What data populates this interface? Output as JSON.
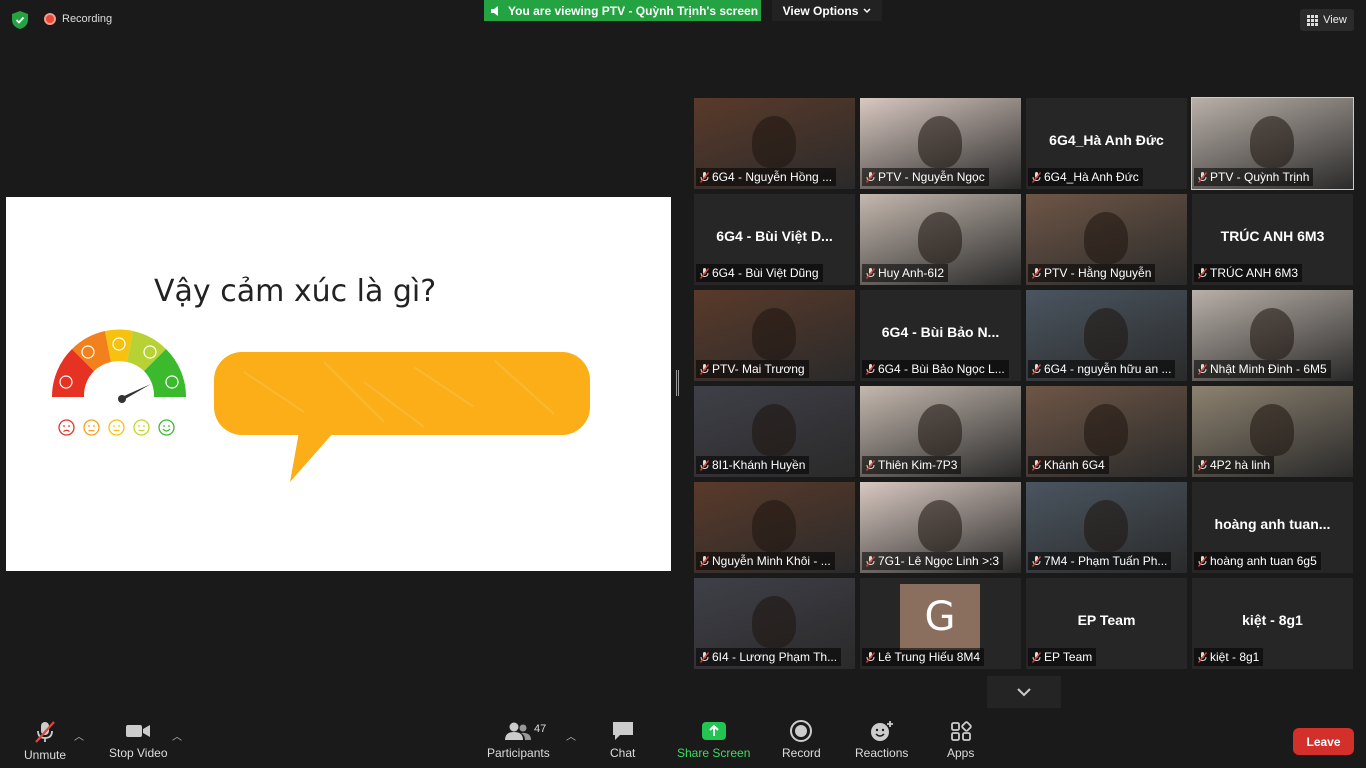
{
  "topbar": {
    "recording_label": "Recording",
    "viewing_banner": "You are viewing PTV - Quỳnh Trịnh's screen",
    "view_options": "View Options",
    "view_label": "View"
  },
  "slide": {
    "title": "Vậy cảm xúc là gì?"
  },
  "gallery": {
    "tiles": [
      {
        "label": "6G4 - Nguyễn Hồng ...",
        "center": "",
        "video": true
      },
      {
        "label": "PTV - Nguyễn Ngọc",
        "center": "",
        "video": true
      },
      {
        "label": "6G4_Hà Anh Đức",
        "center": "6G4_Hà Anh Đức",
        "video": false
      },
      {
        "label": "PTV - Quỳnh Trịnh",
        "center": "",
        "video": true,
        "active": true
      },
      {
        "label": "6G4 - Bùi Việt Dũng",
        "center": "6G4 - Bùi Việt D...",
        "video": false
      },
      {
        "label": "Huy Anh-6I2",
        "center": "",
        "video": true
      },
      {
        "label": "PTV - Hằng Nguyễn",
        "center": "",
        "video": true
      },
      {
        "label": "TRÚC ANH 6M3",
        "center": "TRÚC ANH 6M3",
        "video": false
      },
      {
        "label": "PTV- Mai Trương",
        "center": "",
        "video": true
      },
      {
        "label": "6G4 - Bùi Bảo Ngọc L...",
        "center": "6G4 - Bùi Bảo N...",
        "video": false
      },
      {
        "label": "6G4 - nguyễn hữu an ...",
        "center": "",
        "video": true
      },
      {
        "label": "Nhật Minh Đinh - 6M5",
        "center": "",
        "video": true
      },
      {
        "label": "8I1-Khánh Huyền",
        "center": "",
        "video": true
      },
      {
        "label": "Thiên Kim-7P3",
        "center": "",
        "video": true
      },
      {
        "label": "Khánh 6G4",
        "center": "",
        "video": true
      },
      {
        "label": "4P2 hà linh",
        "center": "",
        "video": true
      },
      {
        "label": "Nguyễn Minh Khôi - ...",
        "center": "",
        "video": true
      },
      {
        "label": "7G1- Lê Ngọc Linh >:3",
        "center": "",
        "video": true
      },
      {
        "label": "7M4 - Phạm Tuấn Ph...",
        "center": "",
        "video": true
      },
      {
        "label": "hoàng anh tuan 6g5",
        "center": "hoàng anh tuan...",
        "video": false
      },
      {
        "label": "6I4 - Lương Phạm Th...",
        "center": "",
        "video": true
      },
      {
        "label": "Lê Trung Hiếu 8M4",
        "center": "",
        "video": false,
        "avatar": "G"
      },
      {
        "label": "EP Team",
        "center": "EP Team",
        "video": false
      },
      {
        "label": "kiệt - 8g1",
        "center": "kiệt - 8g1",
        "video": false
      }
    ]
  },
  "toolbar": {
    "unmute": "Unmute",
    "stop_video": "Stop Video",
    "participants": "Participants",
    "participants_count": "47",
    "chat": "Chat",
    "share_screen": "Share Screen",
    "record": "Record",
    "reactions": "Reactions",
    "apps": "Apps",
    "leave": "Leave"
  }
}
